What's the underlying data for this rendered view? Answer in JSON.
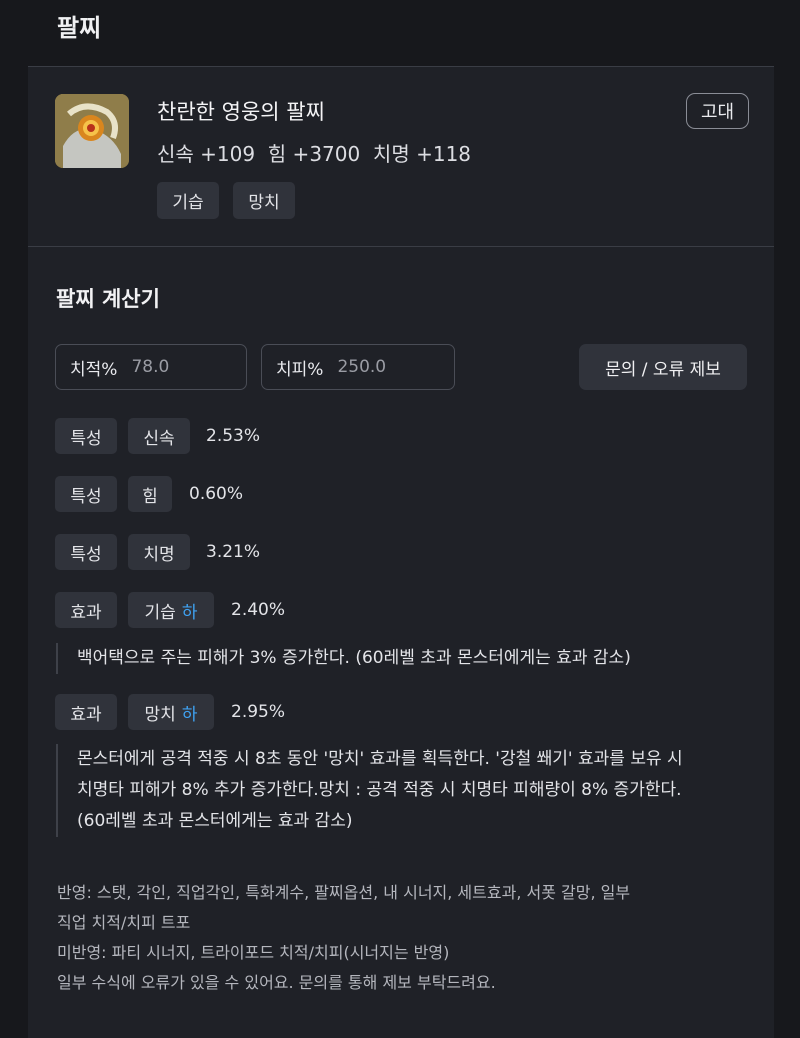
{
  "page": {
    "title": "팔찌"
  },
  "item": {
    "icon": "bracelet-icon",
    "name": "찬란한 영웅의 팔찌",
    "stats": "신속 +109  힘 +3700  치명 +118",
    "grade": "고대",
    "tags": [
      "기습",
      "망치"
    ]
  },
  "calculator": {
    "title": "팔찌 계산기",
    "crit_rate": {
      "label": "치적%",
      "placeholder": "78.0"
    },
    "crit_damage": {
      "label": "치피%",
      "placeholder": "250.0"
    },
    "report_label": "문의 / 오류 제보",
    "rows": [
      {
        "type": "특성",
        "name": "신속",
        "grade": "",
        "value": "2.53%"
      },
      {
        "type": "특성",
        "name": "힘",
        "grade": "",
        "value": "0.60%"
      },
      {
        "type": "특성",
        "name": "치명",
        "grade": "",
        "value": "3.21%"
      },
      {
        "type": "효과",
        "name": "기습",
        "grade": "하",
        "value": "2.40%",
        "desc": "백어택으로 주는 피해가 3% 증가한다. (60레벨 초과 몬스터에게는 효과 감소)"
      },
      {
        "type": "효과",
        "name": "망치",
        "grade": "하",
        "value": "2.95%",
        "desc_lines": [
          "몬스터에게 공격 적중 시 8초 동안 '망치' 효과를 획득한다. '강철 쐐기' 효과를 보유 시",
          "치명타 피해가 8% 추가 증가한다.망치 : 공격 적중 시 치명타 피해량이 8% 증가한다.",
          "(60레벨 초과 몬스터에게는 효과 감소)"
        ]
      }
    ]
  },
  "notes": {
    "applied_1": "반영: 스탯, 각인, 직업각인, 특화계수, 팔찌옵션, 내 시너지, 세트효과, 서폿 갈망, 일부",
    "applied_2": "직업 치적/치피 트포",
    "not_applied": "미반영: 파티 시너지, 트라이포드 치적/치피(시너지는 반영)",
    "disclaimer": "일부 수식에 오류가 있을 수 있어요. 문의를 통해 제보 부탁드려요."
  }
}
